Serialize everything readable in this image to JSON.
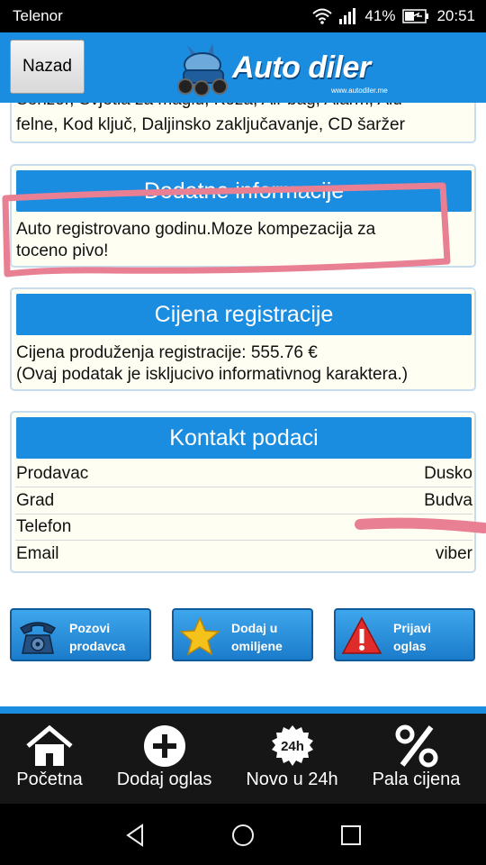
{
  "status_bar": {
    "carrier": "Telenor",
    "battery": "41%",
    "time": "20:51"
  },
  "header": {
    "back_label": "Nazad",
    "logo_text": "Auto diler",
    "logo_url_text": "www.autodiler.me",
    "colors": {
      "header_bg": "#1b8de0",
      "tabbar_bg": "#161616"
    }
  },
  "equipment": {
    "line1": "Senzor, Svjetla za maglu, Koža, Air bag, Alarm, Alu",
    "line2": "felne, Kod ključ, Daljinsko zaključavanje, CD šaržer"
  },
  "extra_info": {
    "title": "Dodatne informacije",
    "line1": "Auto registrovano godinu.Moze kompezacija za",
    "line2": "toceno pivo!"
  },
  "registration": {
    "title": "Cijena registracije",
    "line1": "Cijena produženja registracije: 555.76 €",
    "line2": "(Ovaj podatak je iskljucivo informativnog karaktera.)"
  },
  "contact": {
    "title": "Kontakt podaci",
    "rows": [
      {
        "label": "Prodavac",
        "value": "Dusko"
      },
      {
        "label": "Grad",
        "value": "Budva"
      },
      {
        "label": "Telefon",
        "value": ""
      },
      {
        "label": "Email",
        "value": "viber"
      }
    ]
  },
  "actions": {
    "call": "Pozovi prodavca",
    "call_l1": "Pozovi",
    "call_l2": "prodavca",
    "fav_l1": "Dodaj u",
    "fav_l2": "omiljene",
    "report_l1": "Prijavi",
    "report_l2": "oglas"
  },
  "tabs": [
    {
      "label": "Početna",
      "icon": "home-icon"
    },
    {
      "label": "Dodaj oglas",
      "icon": "plus-icon"
    },
    {
      "label": "Novo u 24h",
      "icon": "24h-badge-icon"
    },
    {
      "label": "Pala cijena",
      "icon": "percent-icon"
    }
  ],
  "badge_24h": "24h"
}
